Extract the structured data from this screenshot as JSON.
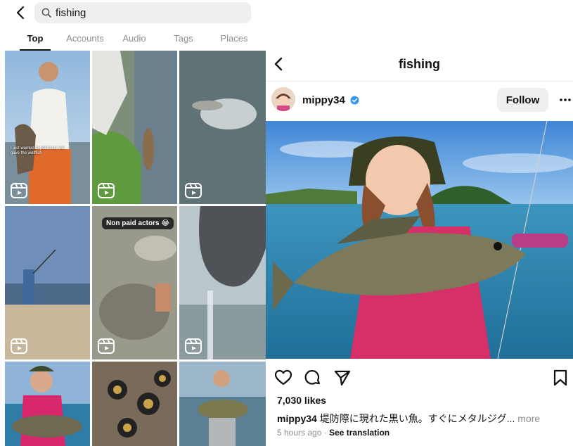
{
  "search": {
    "query": "fishing"
  },
  "tabs": [
    {
      "label": "Top",
      "active": true
    },
    {
      "label": "Accounts",
      "active": false
    },
    {
      "label": "Audio",
      "active": false
    },
    {
      "label": "Tags",
      "active": false
    },
    {
      "label": "Places",
      "active": false
    }
  ],
  "grid": {
    "tile_2_caption": "I just wanted to point out, we gave the wolffish",
    "tile_5_label": "Non paid actors 😂"
  },
  "post": {
    "header_title": "fishing",
    "username": "mippy34",
    "follow_label": "Follow",
    "likes": "7,030 likes",
    "caption_user": "mippy34",
    "caption_text": "堤防際に現れた黒い魚。すぐにメタルジグ...",
    "caption_more": "more",
    "time": "5 hours ago",
    "separator": "·",
    "see_translation": "See translation"
  },
  "colors": {
    "accent_verified": "#3797f0",
    "follow_bg": "#efefef",
    "muted_text": "#8e8e8e"
  },
  "icons": [
    "back-arrow-icon",
    "search-icon",
    "reel-icon",
    "verified-badge-icon",
    "more-options-icon",
    "heart-icon",
    "comment-icon",
    "share-icon",
    "bookmark-icon"
  ]
}
